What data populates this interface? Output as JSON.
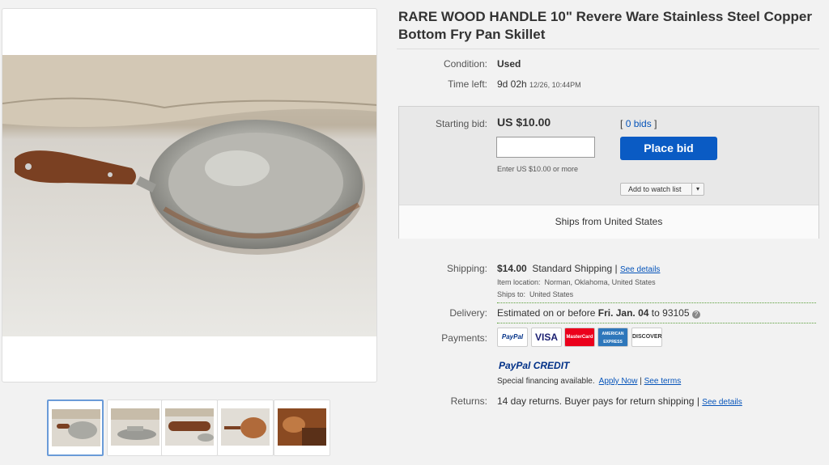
{
  "title": "RARE WOOD HANDLE 10\" Revere Ware Stainless Steel Copper Bottom Fry Pan Skillet",
  "condition": {
    "label": "Condition:",
    "value": "Used"
  },
  "time_left": {
    "label": "Time left:",
    "value": "9d 02h",
    "end": "12/26, 10:44PM"
  },
  "bid": {
    "label": "Starting bid:",
    "price": "US $10.00",
    "bids_prefix": "[",
    "bids_link": "0 bids",
    "bids_suffix": "]",
    "input_placeholder": "",
    "hint": "Enter US $10.00 or more",
    "place_bid": "Place bid",
    "watch": "Add to watch list",
    "ships_from": "Ships from United States"
  },
  "shipping": {
    "label": "Shipping:",
    "cost": "$14.00",
    "method": "Standard Shipping",
    "sep": "|",
    "details_link": "See details",
    "location_label": "Item location:",
    "location": "Norman, Oklahoma, United States",
    "ships_to_label": "Ships to:",
    "ships_to": "United States"
  },
  "delivery": {
    "label": "Delivery:",
    "prefix": "Estimated on or before",
    "date": "Fri. Jan. 04",
    "suffix": "to 93105"
  },
  "payments": {
    "label": "Payments:",
    "logos": [
      "PayPal",
      "VISA",
      "MasterCard",
      "AMERICAN EXPRESS",
      "DISCOVER"
    ],
    "paypal_credit": "PayPal CREDIT",
    "financing": "Special financing available.",
    "apply": "Apply Now",
    "sep": "|",
    "terms": "See terms"
  },
  "returns": {
    "label": "Returns:",
    "value": "14 day returns. Buyer pays for return shipping",
    "sep": "|",
    "details_link": "See details"
  },
  "colors": {
    "accent": "#0a5bc4",
    "link": "#0654ba",
    "paypal_blue": "#003087",
    "paypal_light": "#009cde"
  }
}
